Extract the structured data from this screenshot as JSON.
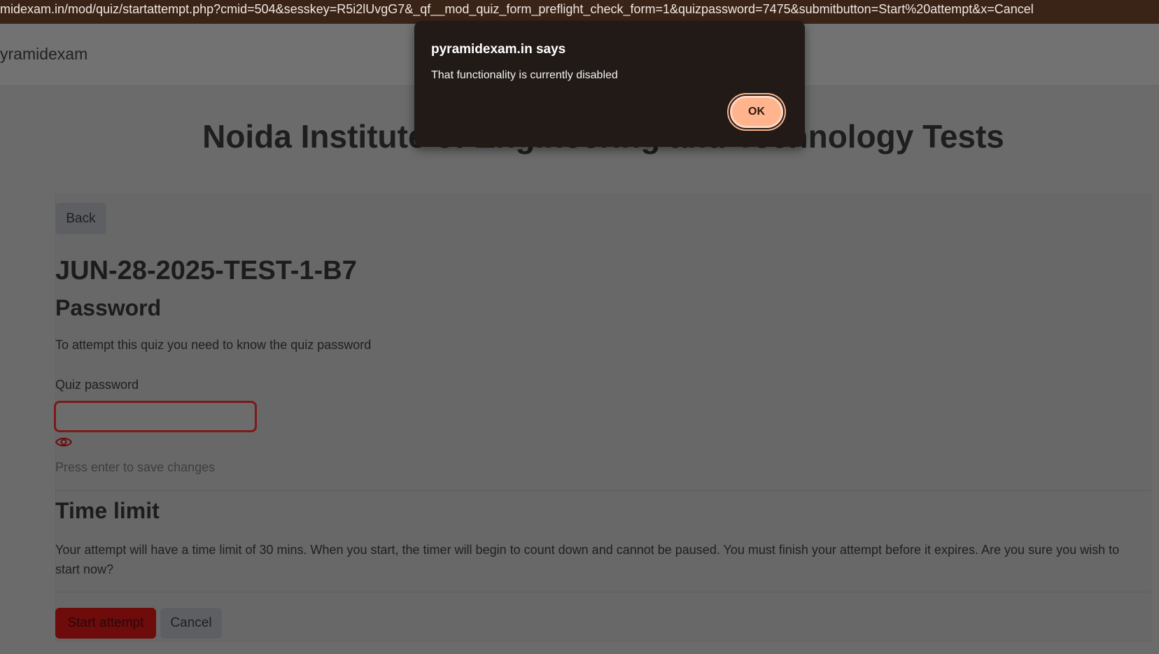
{
  "browser": {
    "url": "midexam.in/mod/quiz/startattempt.php?cmid=504&sesskey=R5i2lUvgG7&_qf__mod_quiz_form_preflight_check_form=1&quizpassword=7475&submitbutton=Start%20attempt&x=Cancel"
  },
  "navbar": {
    "brand": "yramidexam"
  },
  "page": {
    "heading": "Noida Institute of Engineering and Technology Tests",
    "back_label": "Back",
    "quiz_title": "JUN-28-2025-TEST-1-B7",
    "password_section": {
      "heading": "Password",
      "info": "To attempt this quiz you need to know the quiz password",
      "label": "Quiz password",
      "value": "",
      "hint": "Press enter to save changes",
      "reveal_icon": "eye-icon"
    },
    "time_limit_section": {
      "heading": "Time limit",
      "info": "Your attempt will have a time limit of 30 mins. When you start, the timer will begin to count down and cannot be paused. You must finish your attempt before it expires. Are you sure you wish to start now?"
    },
    "start_label": "Start attempt",
    "cancel_label": "Cancel"
  },
  "dialog": {
    "title": "pyramidexam.in says",
    "message": "That functionality is currently disabled",
    "ok_label": "OK"
  },
  "colors": {
    "dialog_bg": "#211a17",
    "ok_button": "#ffb48d",
    "primary_button": "#6e0b0b",
    "address_bar": "#3a2418"
  }
}
